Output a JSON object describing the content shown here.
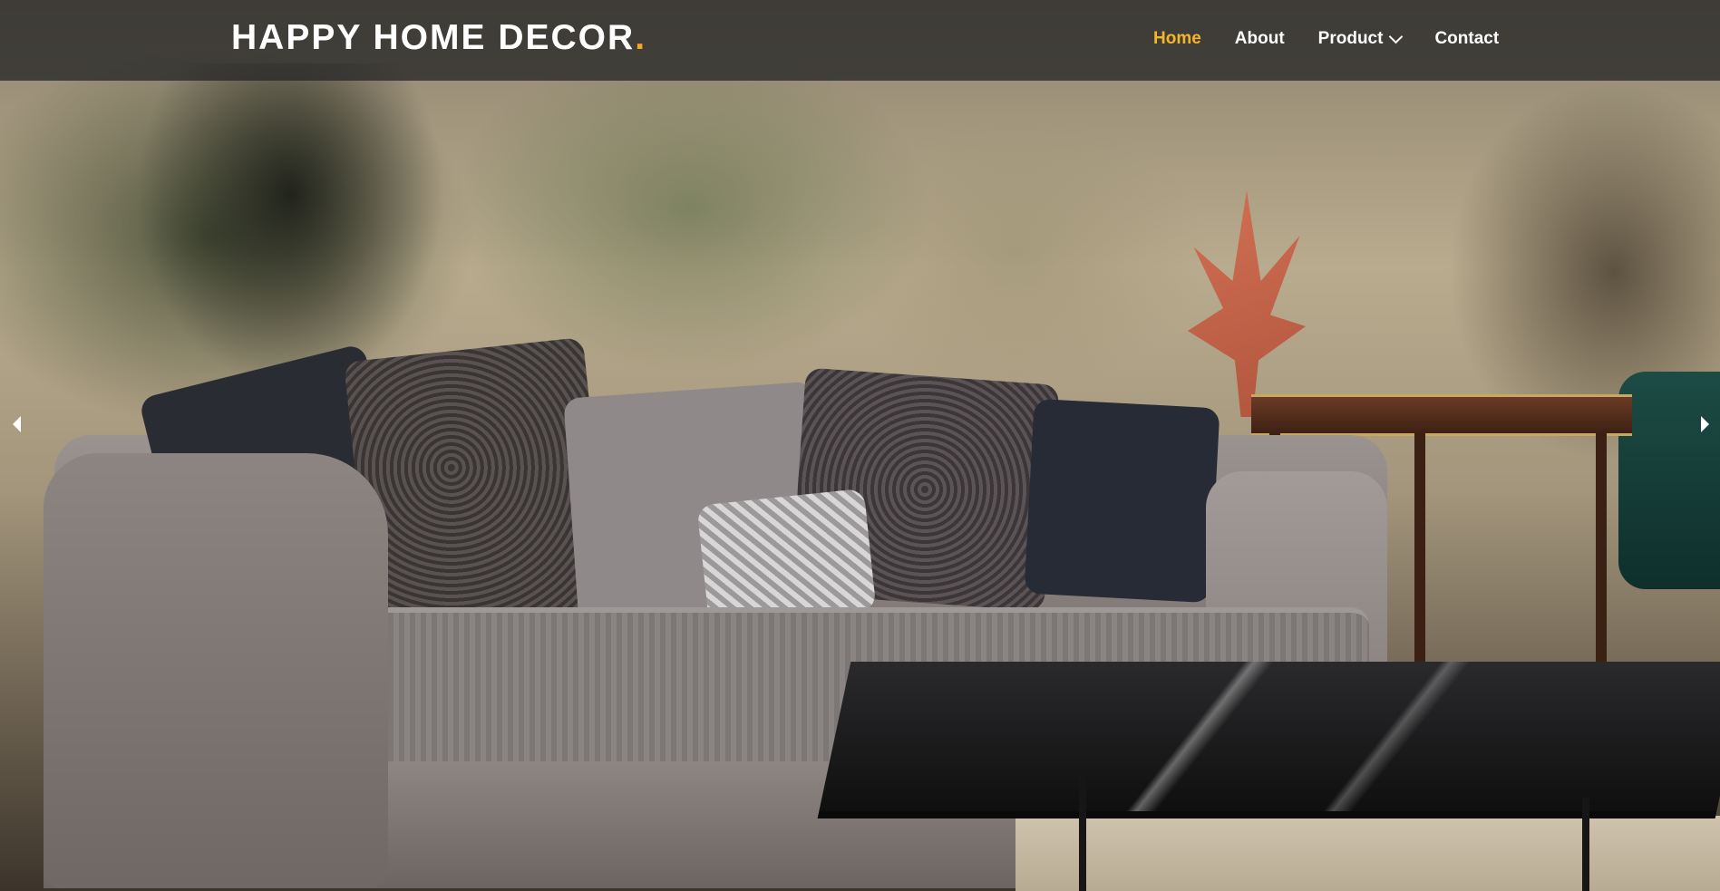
{
  "header": {
    "brand_text": "HAPPY HOME DECOR",
    "brand_dot": ".",
    "brand_accent_color": "#f5a623"
  },
  "nav": {
    "items": [
      {
        "label": "Home",
        "active": true
      },
      {
        "label": "About",
        "active": false
      },
      {
        "label": "Product",
        "active": false,
        "has_dropdown": true
      },
      {
        "label": "Contact",
        "active": false
      }
    ],
    "active_color": "#f5b52a",
    "dropdown_icon": "chevron-down-icon"
  },
  "hero": {
    "image_description_icon": "hero-image",
    "prev_icon": "arrow-left-icon",
    "next_icon": "arrow-right-icon"
  }
}
